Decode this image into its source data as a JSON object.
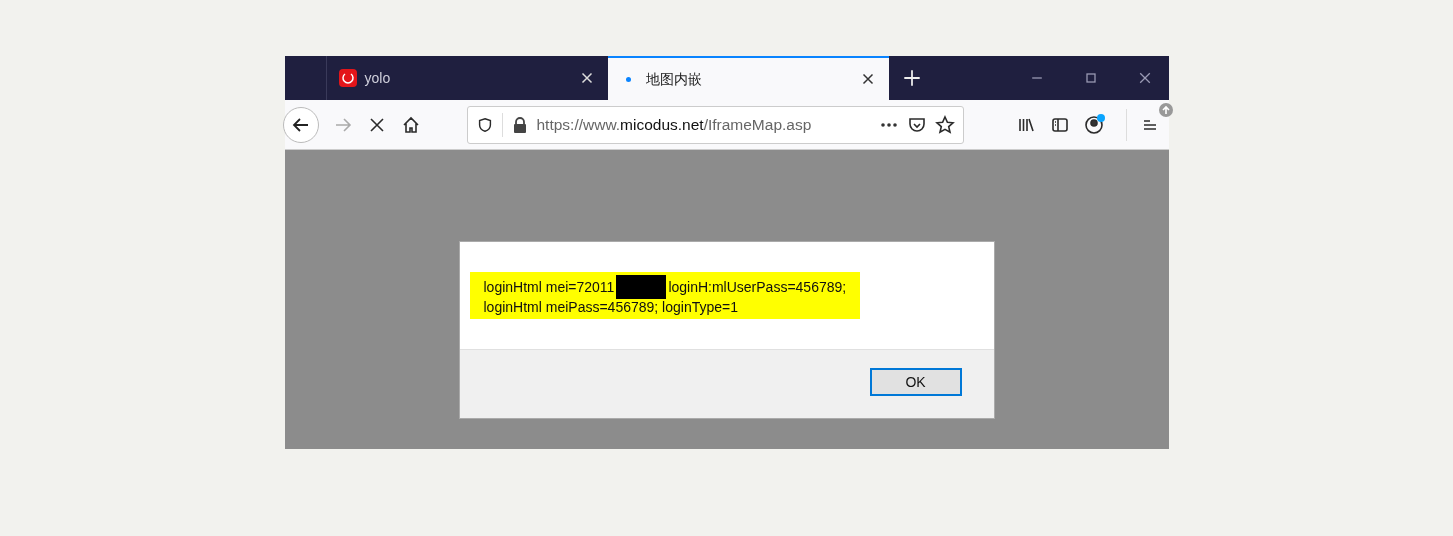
{
  "tabs": [
    {
      "label": "yolo",
      "selected": false,
      "kind": "favicon"
    },
    {
      "label": "地图内嵌",
      "selected": true,
      "kind": "loading"
    }
  ],
  "address_bar": {
    "url_prefix": "https://www.",
    "url_domain": "micodus.net",
    "url_suffix": "/IframeMap.asp"
  },
  "dialog": {
    "message_lines": [
      [
        "loginHtml mei=72011",
        "loginH:mlUserPass=456789;"
      ],
      [
        "loginHtml meiPass=456789; loginType=1"
      ]
    ],
    "button": "OK"
  }
}
